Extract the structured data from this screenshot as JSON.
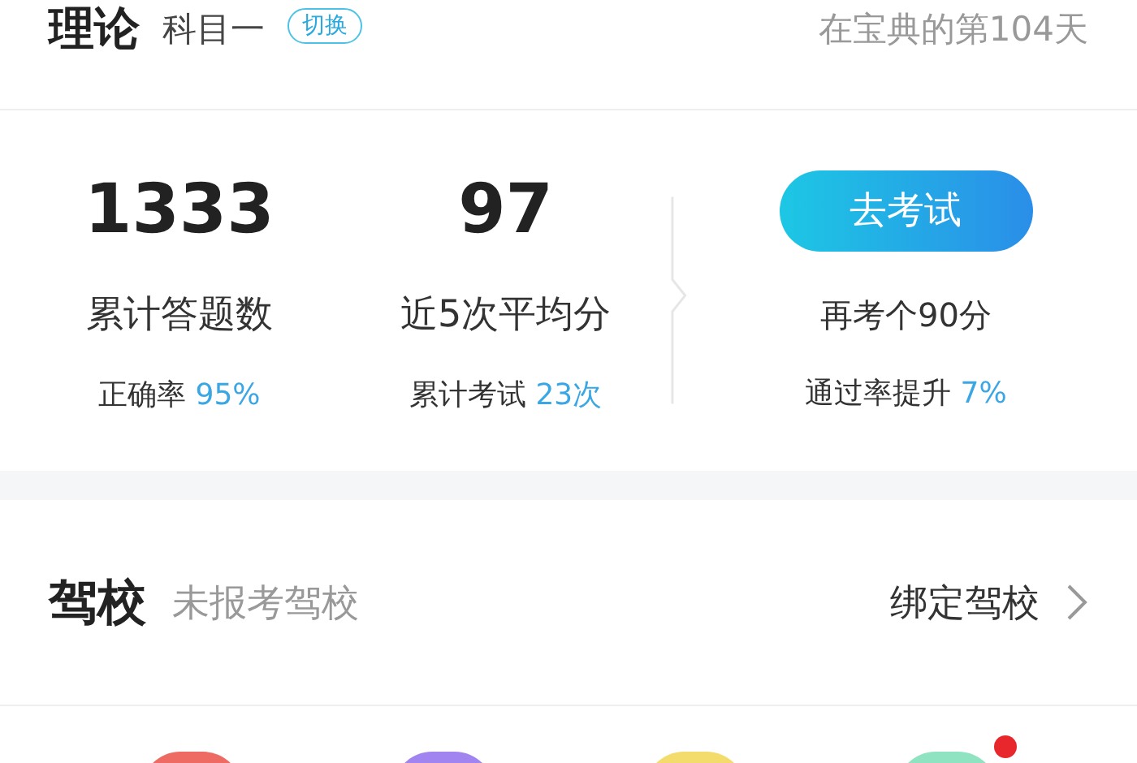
{
  "header": {
    "title": "理论",
    "subject": "科目一",
    "switch_label": "切换",
    "days_text": "在宝典的第104天"
  },
  "stats": [
    {
      "value": "1333",
      "label": "累计答题数",
      "sub_label": "正确率",
      "sub_value": "95%"
    },
    {
      "value": "97",
      "label": "近5次平均分",
      "sub_label": "累计考试",
      "sub_value": "23次"
    }
  ],
  "exam": {
    "button": "去考试",
    "hint": "再考个90分",
    "sub_label": "通过率提升",
    "sub_value": "7%"
  },
  "school": {
    "title": "驾校",
    "status": "未报考驾校",
    "action": "绑定驾校"
  },
  "shortcuts": [
    {
      "color": "#ee6b63",
      "badge": false
    },
    {
      "color": "#a184f0",
      "badge": false
    },
    {
      "color": "#f4dc6c",
      "badge": false
    },
    {
      "color": "#8fe3c0",
      "badge": true
    }
  ]
}
